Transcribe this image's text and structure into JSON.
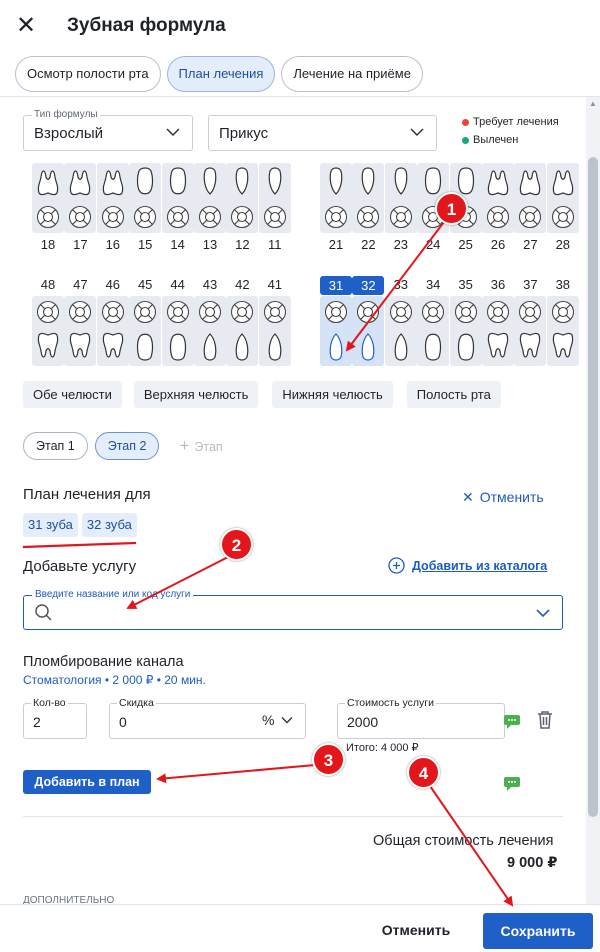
{
  "header": {
    "close_icon": "close-icon",
    "title": "Зубная формула"
  },
  "tabs": [
    {
      "label": "Осмотр полости рта",
      "active": false
    },
    {
      "label": "План лечения",
      "active": true
    },
    {
      "label": "Лечение на приёме",
      "active": false
    }
  ],
  "formula_type": {
    "label": "Тип формулы",
    "value": "Взрослый"
  },
  "bite": {
    "value": "Прикус"
  },
  "legend": [
    {
      "label": "Требует лечения",
      "color": "#e8453c"
    },
    {
      "label": "Вылечен",
      "color": "#1aa67b"
    }
  ],
  "teeth": {
    "upper": [
      "18",
      "17",
      "16",
      "15",
      "14",
      "13",
      "12",
      "11",
      "21",
      "22",
      "23",
      "24",
      "25",
      "26",
      "27",
      "28"
    ],
    "lower": [
      "48",
      "47",
      "46",
      "45",
      "44",
      "43",
      "42",
      "41",
      "31",
      "32",
      "33",
      "34",
      "35",
      "36",
      "37",
      "38"
    ],
    "selected": [
      "31",
      "32"
    ]
  },
  "jaw_filters": [
    "Обе челюсти",
    "Верхняя челюсть",
    "Нижняя челюсть",
    "Полость рта"
  ],
  "stages": {
    "items": [
      "Этап 1",
      "Этап 2"
    ],
    "add_label": "Этап"
  },
  "plan": {
    "title": "План лечения для",
    "cancel": "Отменить",
    "teeth": [
      "31 зуба",
      "32 зуба"
    ]
  },
  "service": {
    "title": "Добавьте услугу",
    "catalog_link": "Добавить из каталога",
    "search_label": "Введите название или код услуги",
    "search_value": ""
  },
  "item": {
    "name": "Пломбирование канала",
    "meta": "Стоматология • 2 000 ₽ • 20 мин.",
    "qty_label": "Кол-во",
    "qty": "2",
    "discount_label": "Скидка",
    "discount": "0",
    "discount_unit": "%",
    "cost_label": "Стоимость услуги",
    "cost": "2000",
    "total": "Итого: 4 000 ₽"
  },
  "add_to_plan": "Добавить в план",
  "total": {
    "label": "Общая стоимость лечения",
    "value": "9 000 ₽"
  },
  "additional": "ДОПОЛНИТЕЛЬНО",
  "footer": {
    "cancel": "Отменить",
    "save": "Сохранить"
  },
  "annotations": [
    "1",
    "2",
    "3",
    "4"
  ]
}
